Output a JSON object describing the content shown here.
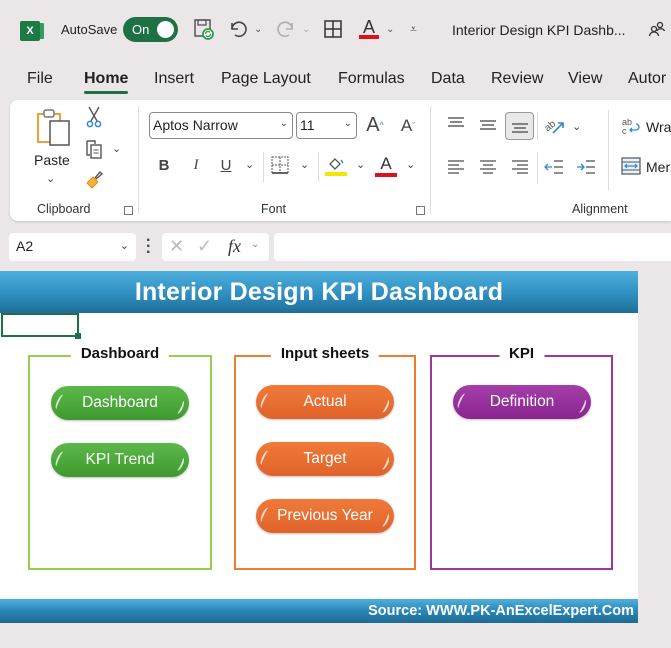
{
  "titlebar": {
    "app_icon": "excel-logo-icon",
    "app_letter": "X",
    "autosave_label": "AutoSave",
    "autosave_state": "On",
    "document_title": "Interior Design KPI Dashb...",
    "icons": [
      "save-icon",
      "undo-icon",
      "redo-icon",
      "borders-icon",
      "font-color-icon",
      "customize-toolbar-icon",
      "share-people-icon"
    ]
  },
  "menu": {
    "tabs": [
      {
        "label": "File",
        "active": false
      },
      {
        "label": "Home",
        "active": true
      },
      {
        "label": "Insert",
        "active": false
      },
      {
        "label": "Page Layout",
        "active": false
      },
      {
        "label": "Formulas",
        "active": false
      },
      {
        "label": "Data",
        "active": false
      },
      {
        "label": "Review",
        "active": false
      },
      {
        "label": "View",
        "active": false
      },
      {
        "label": "Autor",
        "active": false
      }
    ]
  },
  "ribbon": {
    "clipboard": {
      "label": "Clipboard",
      "paste_label": "Paste"
    },
    "font": {
      "label": "Font",
      "font_name": "Aptos Narrow",
      "font_size": "11",
      "bold": "B",
      "italic": "I",
      "underline": "U",
      "highlight_color": "#f5e600",
      "font_color": "#d9141e"
    },
    "alignment": {
      "label": "Alignment",
      "wrap_label": "Wra",
      "merge_label": "Mer"
    }
  },
  "formula_bar": {
    "name_box": "A2",
    "fx_label": "fx",
    "formula_value": ""
  },
  "sheet": {
    "banner_title": "Interior Design KPI Dashboard",
    "footer_source": "Source: WWW.PK-AnExcelExpert.Com",
    "colors": {
      "banner": "#2f8fc0",
      "green": "#4caf3a",
      "orange": "#e8692f",
      "purple": "#962c9c"
    },
    "groups": [
      {
        "title": "Dashboard",
        "color": "#92d050",
        "buttons": [
          "Dashboard",
          "KPI Trend"
        ]
      },
      {
        "title": "Input sheets",
        "color": "#ed7d31",
        "buttons": [
          "Actual",
          "Target",
          "Previous Year"
        ]
      },
      {
        "title": "KPI",
        "color": "#9a3aa0",
        "buttons": [
          "Definition"
        ]
      }
    ]
  }
}
